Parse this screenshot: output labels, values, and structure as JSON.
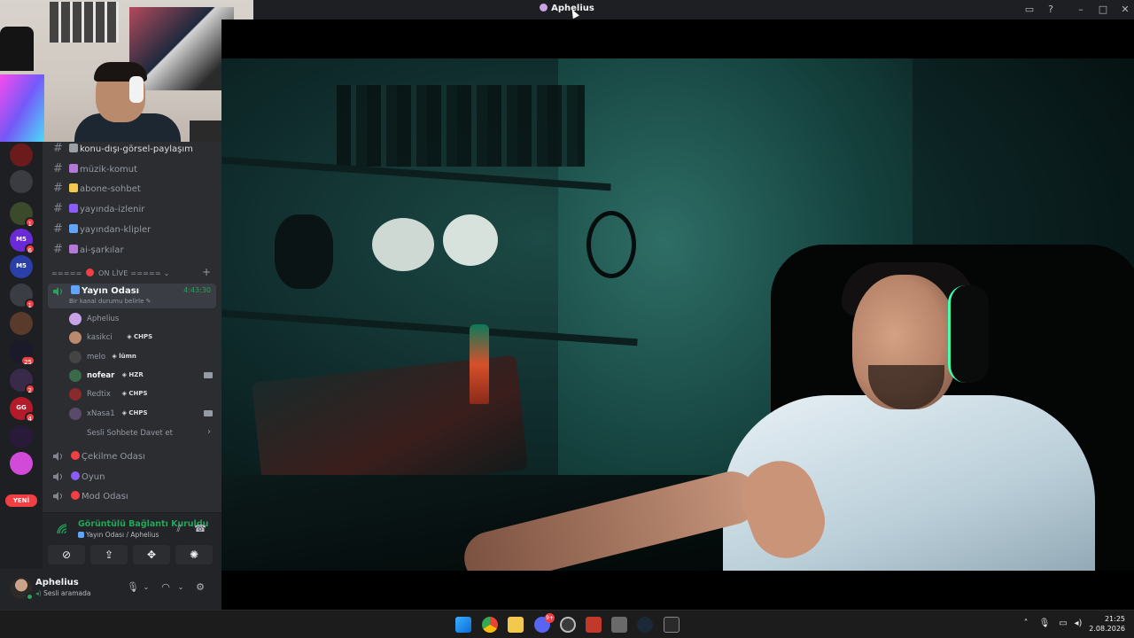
{
  "window": {
    "title": "Aphelius"
  },
  "servers": [
    {
      "badge": "",
      "text": "",
      "color": "#6b1b1b"
    },
    {
      "badge": "",
      "text": "",
      "color": "#3a3c42"
    },
    {
      "badge": "1",
      "text": "",
      "color": "#3a4a2a"
    },
    {
      "badge": "6",
      "text": "M5",
      "color": "#6b2ad8"
    },
    {
      "badge": "",
      "text": "M5",
      "color": "#2a3fa8"
    },
    {
      "badge": "1",
      "text": "",
      "color": "#3b3d44"
    },
    {
      "badge": "",
      "text": "",
      "color": "#5a3a2a"
    },
    {
      "badge": "25",
      "text": "",
      "color": "#1a1a2a"
    },
    {
      "badge": "2",
      "text": "",
      "color": "#3a2a4a"
    },
    {
      "badge": "4",
      "text": "GG",
      "color": "#b31b2a"
    },
    {
      "badge": "",
      "text": "",
      "color": "#2a1a3a"
    },
    {
      "badge": "",
      "text": "",
      "color": "#d24bd8"
    }
  ],
  "new_label": "YENİ",
  "text_channels": [
    {
      "label": "konu-dışı-görsel-paylaşım",
      "emoji_color": "#9aa0a6"
    },
    {
      "label": "müzik-komut",
      "emoji_color": "#b478d8"
    },
    {
      "label": "abone-sohbet",
      "emoji_color": "#f2c94c"
    },
    {
      "label": "yayında-izlenir",
      "emoji_color": "#8b5cf6"
    },
    {
      "label": "yayından-klipler",
      "emoji_color": "#60a5fa"
    },
    {
      "label": "ai-şarkılar",
      "emoji_color": "#b478d8"
    }
  ],
  "category": {
    "prefix": "=====",
    "label": "ON LİVE",
    "suffix": "=====",
    "add": "+"
  },
  "active_voice": {
    "name": "Yayın Odası",
    "status": "Bir kanal durumu belirle",
    "timer": "4:43:30"
  },
  "voice_users": [
    {
      "name": "Aphelius",
      "tag": "",
      "bright": false,
      "camera": false,
      "color": "#c9a2e8"
    },
    {
      "name": "kasikci",
      "tag": "CHPS",
      "bright": false,
      "camera": false,
      "color": "#b98a6c"
    },
    {
      "name": "melo",
      "tag": "lümn",
      "bright": false,
      "camera": false,
      "color": "#444"
    },
    {
      "name": "nofear",
      "tag": "HZR",
      "bright": true,
      "camera": true,
      "color": "#3a6a4a"
    },
    {
      "name": "Redtix",
      "tag": "CHPS",
      "bright": false,
      "camera": false,
      "color": "#8a2a2a"
    },
    {
      "name": "xNasa1",
      "tag": "CHPS",
      "bright": false,
      "camera": true,
      "color": "#5a4a6a"
    }
  ],
  "invite_label": "Sesli Sohbete Davet et",
  "voice_channels": [
    {
      "label": "Çekilme Odası",
      "emoji_color": "#f23f43"
    },
    {
      "label": "Oyun",
      "emoji_color": "#8b5cf6"
    },
    {
      "label": "Mod Odası",
      "emoji_color": "#f23f43"
    }
  ],
  "voice_panel": {
    "state": "Görüntülü Bağlantı Kuruldu",
    "location": "Yayın Odası / Aphelius"
  },
  "user_panel": {
    "name": "Aphelius",
    "status": "Sesli aramada"
  },
  "clock": {
    "time": "21:25",
    "date": "2.08.2026"
  },
  "taskbar_badge": "9+",
  "colors": {
    "sidebar": "#2b2d31",
    "rail": "#1e1f22",
    "accent_green": "#23a55a",
    "danger": "#f23f43"
  }
}
